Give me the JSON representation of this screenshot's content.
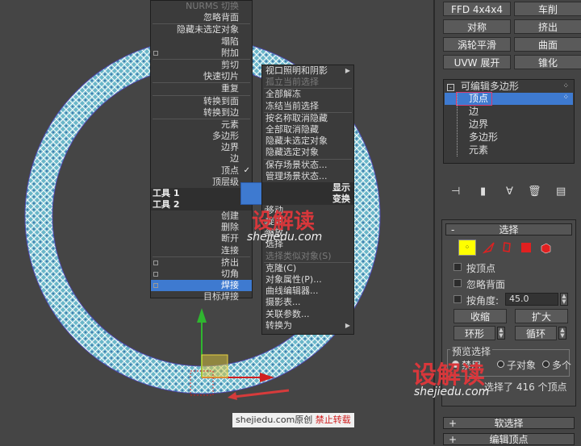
{
  "quad_left": {
    "items": [
      {
        "label": "NURMS 切换",
        "dim": true
      },
      {
        "label": "忽略背面"
      },
      {
        "sep": true
      },
      {
        "label": "隐藏未选定对象"
      },
      {
        "label": "塌陷"
      },
      {
        "label": "附加",
        "box": true
      },
      {
        "sep": true
      },
      {
        "label": "剪切"
      },
      {
        "label": "快速切片"
      },
      {
        "sep": true
      },
      {
        "label": "重复"
      },
      {
        "sep": true
      },
      {
        "label": "转换到面"
      },
      {
        "label": "转换到边"
      },
      {
        "sep": true
      },
      {
        "label": "元素"
      },
      {
        "label": "多边形"
      },
      {
        "label": "边界"
      },
      {
        "label": "边"
      },
      {
        "label": "顶点",
        "tick": "✓"
      },
      {
        "label": "顶层级"
      }
    ],
    "header1": "工具 1",
    "header2": "工具 2",
    "items2": [
      {
        "label": "创建"
      },
      {
        "label": "删除"
      },
      {
        "label": "断开"
      },
      {
        "label": "连接"
      },
      {
        "sep": true
      },
      {
        "label": "挤出",
        "box": true
      },
      {
        "label": "切角",
        "box": true
      },
      {
        "label": "焊接",
        "box": true,
        "selected": true
      },
      {
        "label": "目标焊接"
      }
    ]
  },
  "quad_right": {
    "items": [
      {
        "label": "视口照明和阴影",
        "arrow": "▶"
      },
      {
        "label": "孤立当前选择",
        "dim": true
      },
      {
        "sep": true
      },
      {
        "label": "全部解冻"
      },
      {
        "label": "冻结当前选择"
      },
      {
        "sep": true
      },
      {
        "label": "按名称取消隐藏"
      },
      {
        "label": "全部取消隐藏"
      },
      {
        "label": "隐藏未选定对象"
      },
      {
        "label": "隐藏选定对象"
      },
      {
        "sep": true
      },
      {
        "label": "保存场景状态..."
      },
      {
        "label": "管理场景状态..."
      }
    ],
    "header1": "显示",
    "header2": "变换",
    "items2": [
      {
        "label": "移动",
        "box": true
      },
      {
        "label": "旋转",
        "box": true
      },
      {
        "label": "缩放",
        "box": true
      },
      {
        "label": "选择"
      },
      {
        "label": "选择类似对象(S)",
        "dim": true
      },
      {
        "sep": true
      },
      {
        "label": "克隆(C)"
      },
      {
        "label": "对象属性(P)..."
      },
      {
        "label": "曲线编辑器..."
      },
      {
        "label": "摄影表..."
      },
      {
        "label": "关联参数..."
      },
      {
        "label": "转换为",
        "arrow": "▶"
      }
    ]
  },
  "watermark": {
    "logo": "设解读",
    "url": "shejiedu.com",
    "footer_url": "shejiedu.com原创",
    "footer_note": "禁止转载"
  },
  "side": {
    "buttons": [
      "FFD 4x4x4",
      "车削",
      "对称",
      "挤出",
      "涡轮平滑",
      "曲面",
      "UVW 展开",
      "锥化"
    ],
    "stack_root": "可编辑多边形",
    "stack_items": [
      "顶点",
      "边",
      "边界",
      "多边形",
      "元素"
    ],
    "select_title": "选择",
    "by_vertex": "按顶点",
    "ignore_back": "忽略背面",
    "by_angle": "按角度:",
    "angle_value": "45.0",
    "shrink": "收缩",
    "grow": "扩大",
    "ring": "环形",
    "loop": "循环",
    "preview_title": "预览选择",
    "preview_opts": [
      "禁用",
      "子对象",
      "多个"
    ],
    "status": "选择了 416 个顶点",
    "soft_sel": "软选择",
    "edit_vert": "编辑顶点",
    "plus": "+",
    "minus": "-"
  },
  "colors": {
    "accent": "#3e7ad0",
    "ring_fill": "#6ab7c9",
    "gizmo_green": "#2fb52f",
    "gizmo_red": "#d02020",
    "watermark_red": "#d8373b",
    "selected_outline": "#d63b6f",
    "vertex_yellow": "#ffff00"
  }
}
